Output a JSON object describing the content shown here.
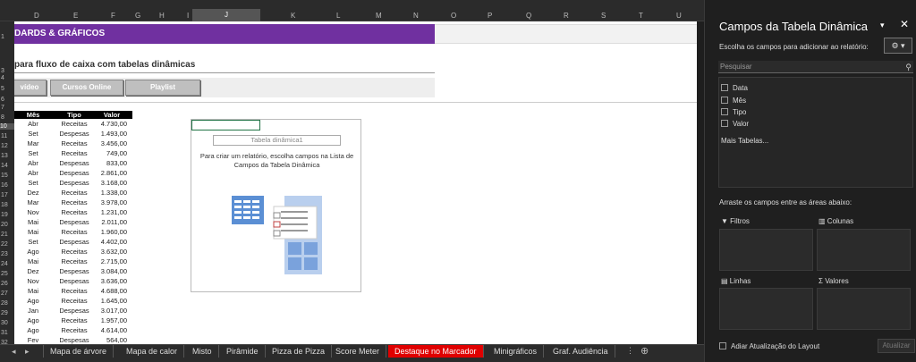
{
  "columns": {
    "headers": [
      "D",
      "E",
      "F",
      "G",
      "H",
      "I",
      "J",
      "K",
      "L",
      "M",
      "N",
      "O",
      "P",
      "Q",
      "R",
      "S",
      "T",
      "U"
    ],
    "selected": "J"
  },
  "rows": [
    "1",
    "",
    "3",
    "4",
    "5",
    "6",
    "7",
    "8",
    "9",
    "10",
    "11",
    "12",
    "13",
    "14",
    "15",
    "16",
    "17",
    "18",
    "19",
    "20",
    "21",
    "22",
    "23",
    "24",
    "25",
    "26",
    "27",
    "28",
    "29",
    "30",
    "31",
    "32",
    ""
  ],
  "sheet": {
    "banner": "DARDS & GRÁFICOS",
    "subtitle": "para fluxo de caixa com tabelas dinâmicas",
    "buttons": [
      "vídeo",
      "Cursos Online",
      "Playlist"
    ],
    "table": {
      "headers": [
        "Mês",
        "Tipo",
        "Valor"
      ],
      "rows": [
        [
          "Abr",
          "Receitas",
          "4.730,00"
        ],
        [
          "Set",
          "Despesas",
          "1.493,00"
        ],
        [
          "Mar",
          "Receitas",
          "3.456,00"
        ],
        [
          "Set",
          "Receitas",
          "749,00"
        ],
        [
          "Abr",
          "Despesas",
          "833,00"
        ],
        [
          "Abr",
          "Despesas",
          "2.861,00"
        ],
        [
          "Set",
          "Despesas",
          "3.168,00"
        ],
        [
          "Dez",
          "Receitas",
          "1.338,00"
        ],
        [
          "Mar",
          "Receitas",
          "3.978,00"
        ],
        [
          "Nov",
          "Receitas",
          "1.231,00"
        ],
        [
          "Mai",
          "Despesas",
          "2.011,00"
        ],
        [
          "Mai",
          "Receitas",
          "1.960,00"
        ],
        [
          "Set",
          "Despesas",
          "4.402,00"
        ],
        [
          "Ago",
          "Receitas",
          "3.632,00"
        ],
        [
          "Mai",
          "Receitas",
          "2.715,00"
        ],
        [
          "Dez",
          "Despesas",
          "3.084,00"
        ],
        [
          "Nov",
          "Despesas",
          "3.636,00"
        ],
        [
          "Mai",
          "Receitas",
          "4.688,00"
        ],
        [
          "Ago",
          "Receitas",
          "1.645,00"
        ],
        [
          "Jan",
          "Despesas",
          "3.017,00"
        ],
        [
          "Ago",
          "Receitas",
          "1.957,00"
        ],
        [
          "Ago",
          "Receitas",
          "4.614,00"
        ],
        [
          "Fev",
          "Despesas",
          "564,00"
        ]
      ]
    },
    "pivot": {
      "name": "Tabela dinâmica1",
      "message": "Para criar um relatório, escolha campos na Lista de Campos da Tabela Dinâmica"
    }
  },
  "tabs": {
    "items": [
      "Mapa de árvore",
      "Mapa de calor",
      "Misto",
      "Pirâmide",
      "Pizza de Pizza",
      "Score Meter",
      "Destaque no Marcador",
      "Minigráficos",
      "Graf. Audiência"
    ],
    "active": "Destaque no Marcador",
    "nav_prev": "◂",
    "nav_next": "▸",
    "add": "⊕",
    "more": "⋮"
  },
  "pane": {
    "title": "Campos da Tabela Dinâmica",
    "caret": "▾",
    "close": "✕",
    "hint": "Escolha os campos para adicionar ao relatório:",
    "gear": "⚙ ▾",
    "search_placeholder": "Pesquisar",
    "fields": [
      "Data",
      "Mês",
      "Tipo",
      "Valor"
    ],
    "more_tables": "Mais Tabelas...",
    "drag_hint": "Arraste os campos entre as áreas abaixo:",
    "areas": {
      "filters": "Filtros",
      "columns": "Colunas",
      "rows": "Linhas",
      "values": "Valores"
    },
    "defer": "Adiar Atualização do Layout",
    "update": "Atualizar"
  },
  "colors": {
    "banner": "#7030a0",
    "active_tab": "#e00000",
    "selection": "#217346"
  }
}
